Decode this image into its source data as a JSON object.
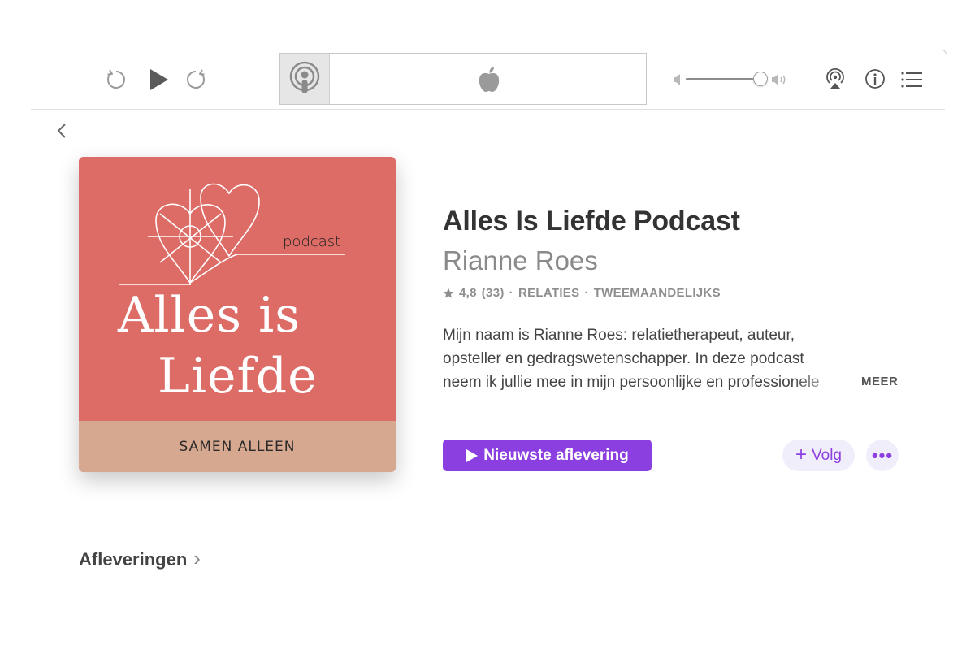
{
  "toolbar": {
    "icons": {
      "skip_back": "skip-back-icon",
      "play": "play-icon",
      "skip_forward": "skip-forward-icon",
      "podcasts_app": "podcasts-app-icon",
      "apple": "apple-logo-icon",
      "volume_low": "volume-low-icon",
      "volume_high": "volume-high-icon",
      "airplay": "airplay-icon",
      "info": "info-icon",
      "list": "list-icon"
    },
    "volume_level": 0.92
  },
  "artwork": {
    "podcast_word": "podcast",
    "title_line1": "Alles is",
    "title_line2": "Liefde",
    "band_text": "SAMEN ALLEEN",
    "colors": {
      "top": "#dd6b66",
      "band": "#d7a890"
    }
  },
  "show": {
    "title": "Alles Is Liefde Podcast",
    "author": "Rianne Roes",
    "rating": "4,8",
    "rating_count": "(33)",
    "separator": "·",
    "category": "RELATIES",
    "frequency": "TWEEMAANDELIJKS",
    "description_lines": [
      "Mijn naam is Rianne Roes: relatietherapeut, auteur,",
      "opsteller en gedragswetenschapper. In deze podcast",
      "neem ik jullie mee in mijn persoonlijke en professionele"
    ],
    "more_label": "MEER"
  },
  "actions": {
    "newest_label": "Nieuwste aflevering",
    "follow_label": "Volg",
    "follow_plus": "+",
    "more_dots": "•••",
    "accent_color": "#8c3fe0"
  },
  "sections": {
    "episodes_label": "Afleveringen",
    "episodes_chevron": "›"
  }
}
